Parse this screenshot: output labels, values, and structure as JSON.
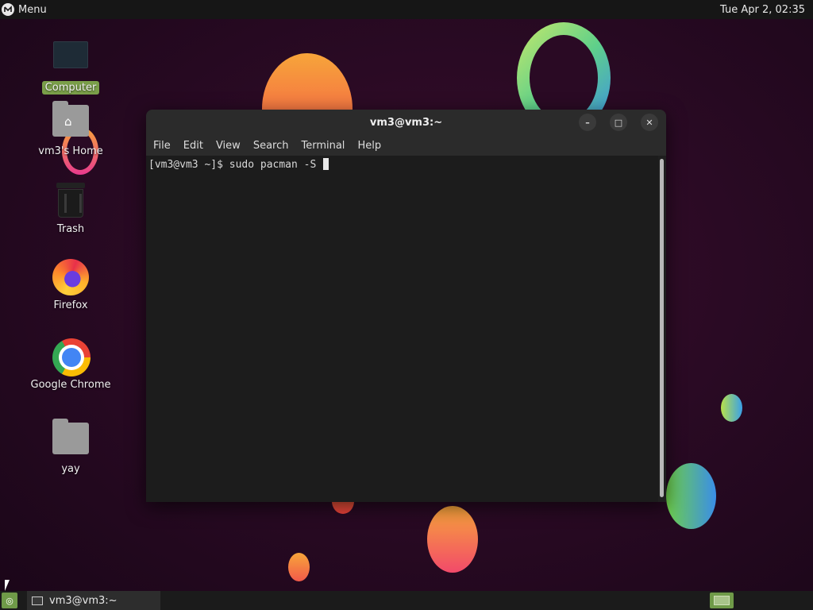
{
  "top_panel": {
    "menu_label": "Menu",
    "clock": "Tue Apr  2, 02:35"
  },
  "desktop_icons": [
    {
      "label": "Computer",
      "icon": "computer-icon",
      "selected": true
    },
    {
      "label": "vm3's Home",
      "icon": "home-folder-icon"
    },
    {
      "label": "Trash",
      "icon": "trash-icon"
    },
    {
      "label": "Firefox",
      "icon": "firefox-icon"
    },
    {
      "label": "Google Chrome",
      "icon": "chrome-icon"
    },
    {
      "label": "yay",
      "icon": "folder-icon"
    }
  ],
  "terminal": {
    "title": "vm3@vm3:~",
    "menu": [
      "File",
      "Edit",
      "View",
      "Search",
      "Terminal",
      "Help"
    ],
    "prompt_line": "[vm3@vm3 ~]$ sudo pacman -S "
  },
  "window_controls": {
    "minimize": "–",
    "maximize": "□",
    "close": "✕"
  },
  "taskbar": {
    "task_label": "vm3@vm3:~"
  },
  "colors": {
    "accent": "#7a9f49",
    "panel": "#161616",
    "terminal_bg": "#1c1c1c"
  }
}
